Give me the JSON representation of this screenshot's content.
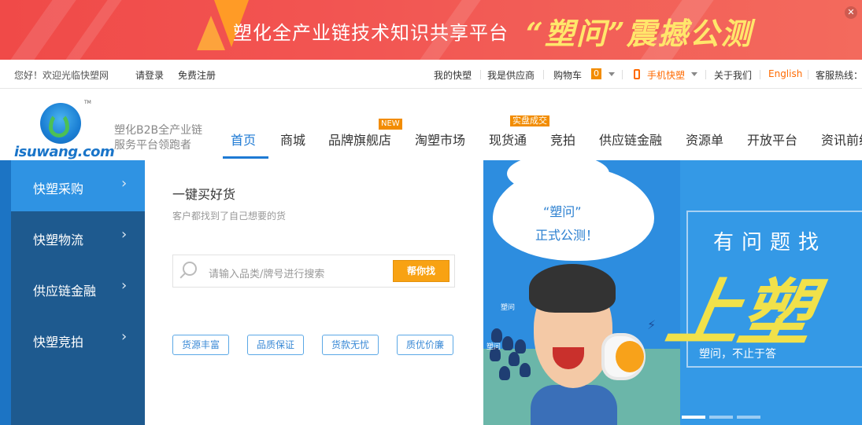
{
  "banner": {
    "text_main": "塑化全产业链技术知识共享平台",
    "text_highlight": "“塑问”震撼公测"
  },
  "topbar": {
    "welcome": "您好！欢迎光临快塑网",
    "login": "请登录",
    "register": "免费注册",
    "my_kuaisu": "我的快塑",
    "supplier": "我是供应商",
    "cart": "购物车",
    "cart_count": "0",
    "mobile": "手机快塑",
    "about": "关于我们",
    "english": "English",
    "hotline": "客服热线："
  },
  "header": {
    "logo_text": "isuwang.com",
    "slogan_line1": "塑化B2B全产业链",
    "slogan_line2": "服务平台领跑者"
  },
  "nav": {
    "items": [
      "首页",
      "商城",
      "品牌旗舰店",
      "淘塑市场",
      "现货通",
      "竞拍",
      "供应链金融",
      "资源单",
      "开放平台",
      "资讯前线"
    ],
    "badge_new": "NEW",
    "badge_deal": "实盘成交"
  },
  "leftmenu": {
    "items": [
      "快塑采购",
      "快塑物流",
      "供应链金融",
      "快塑竞拍"
    ],
    "arrow": "›"
  },
  "middle": {
    "title": "一键买好货",
    "subtitle": "客户都找到了自己想要的货",
    "search_placeholder": "请输入品类/牌号进行搜索",
    "search_button": "帮你找",
    "tags": [
      "货源丰富",
      "品质保证",
      "货款无忧",
      "质优价廉"
    ]
  },
  "promo": {
    "cloud_line1": "“塑问”",
    "cloud_line2": "正式公测！",
    "frame_text": "有问题找",
    "big_text": "上塑",
    "small_text": "塑问，不止于答",
    "tiny_label": "塑问"
  },
  "colors": {
    "accent_blue": "#1e7ad4",
    "menu_dark": "#1e5a8f",
    "orange": "#f28c00"
  }
}
